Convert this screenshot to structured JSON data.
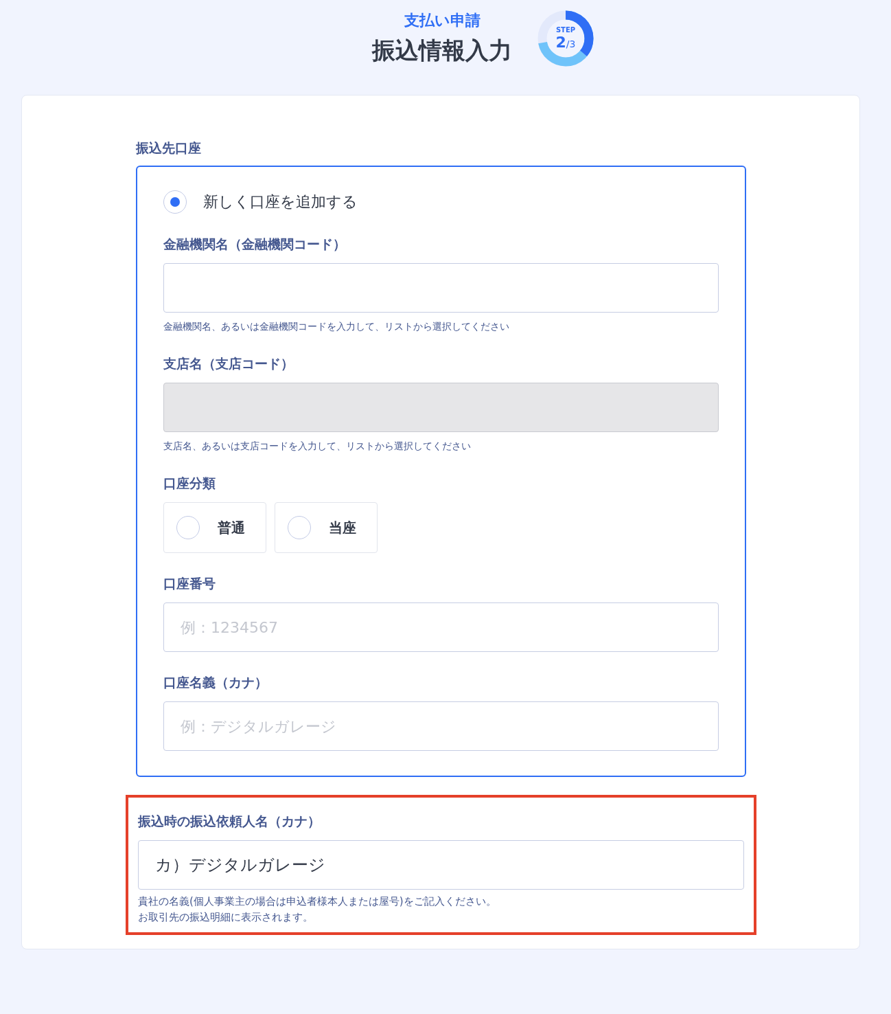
{
  "header": {
    "category": "支払い申請",
    "title": "振込情報入力",
    "step": {
      "label": "STEP",
      "current": "2",
      "total": "/3"
    }
  },
  "account": {
    "label": "振込先口座",
    "option": {
      "label": "新しく口座を追加する",
      "selected": true
    },
    "fields": [
      {
        "kind": "text",
        "label": "金融機関名（金融機関コード）",
        "disabled": false,
        "hint": "金融機関名、あるいは金融機関コードを入力して、リストから選択してください"
      },
      {
        "kind": "text",
        "label": "支店名（支店コード）",
        "disabled": true,
        "hint": "支店名、あるいは支店コードを入力して、リストから選択してください"
      },
      {
        "kind": "choice",
        "label": "口座分類",
        "options": [
          {
            "label": "普通",
            "selected": false
          },
          {
            "label": "当座",
            "selected": false
          }
        ]
      },
      {
        "kind": "text",
        "label": "口座番号",
        "placeholder": "例：1234567",
        "disabled": false
      },
      {
        "kind": "text",
        "label": "口座名義（カナ）",
        "placeholder": "例：デジタルガレージ",
        "disabled": false
      }
    ]
  },
  "requester": {
    "highlighted": true,
    "label": "振込時の振込依頼人名（カナ）",
    "value": "カ）デジタルガレージ",
    "hints": [
      "貴社の名義(個人事業主の場合は申込者様本人または屋号)をご記入ください。",
      "お取引先の振込明細に表示されます。"
    ]
  }
}
